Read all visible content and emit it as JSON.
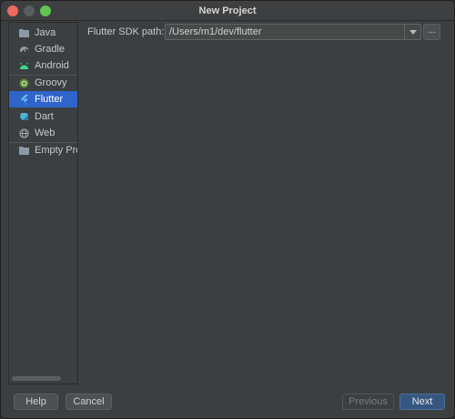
{
  "window": {
    "title": "New Project"
  },
  "sidebar": {
    "items": [
      {
        "label": "Java",
        "icon": "folder-icon",
        "selected": false
      },
      {
        "label": "Gradle",
        "icon": "gradle-elephant-icon",
        "selected": false
      },
      {
        "label": "Android",
        "icon": "android-icon",
        "selected": false
      },
      {
        "label": "Groovy",
        "icon": "groovy-icon",
        "selected": false
      },
      {
        "label": "Flutter",
        "icon": "flutter-icon",
        "selected": true
      },
      {
        "label": "Dart",
        "icon": "dart-icon",
        "selected": false
      },
      {
        "label": "Web",
        "icon": "globe-icon",
        "selected": false
      },
      {
        "label": "Empty Proje",
        "icon": "folder-icon",
        "selected": false
      }
    ]
  },
  "main": {
    "sdk_label": "Flutter SDK path:",
    "sdk_path": "/Users/m1/dev/flutter",
    "browse_label": "..."
  },
  "footer": {
    "help_label": "Help",
    "cancel_label": "Cancel",
    "previous_label": "Previous",
    "next_label": "Next"
  },
  "colors": {
    "selection": "#2f65ca",
    "default_button": "#365880",
    "window_bg": "#3c3f41"
  }
}
